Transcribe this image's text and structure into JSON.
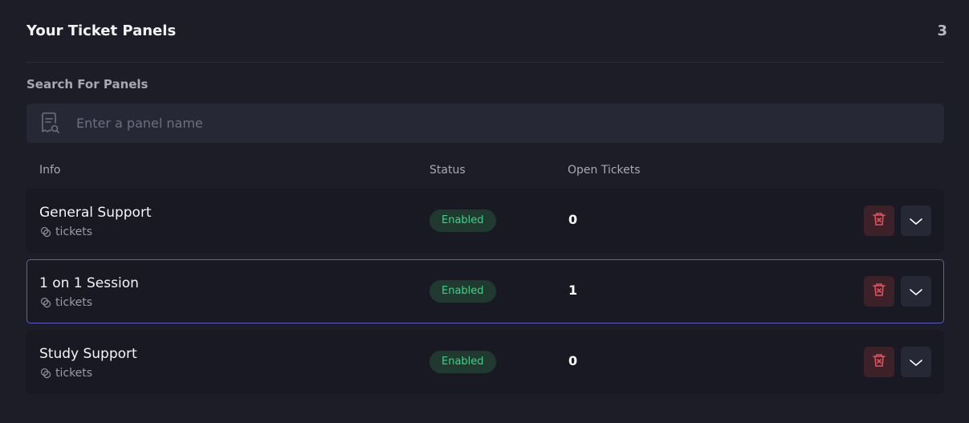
{
  "header": {
    "title": "Your Ticket Panels",
    "count": "3"
  },
  "search": {
    "label": "Search For Panels",
    "placeholder": "Enter a panel name",
    "value": ""
  },
  "table": {
    "columns": {
      "info": "Info",
      "status": "Status",
      "open_tickets": "Open Tickets"
    },
    "rows": [
      {
        "name": "General Support",
        "channel": "tickets",
        "status": "Enabled",
        "open_tickets": "0"
      },
      {
        "name": "1 on 1 Session",
        "channel": "tickets",
        "status": "Enabled",
        "open_tickets": "1"
      },
      {
        "name": "Study Support",
        "channel": "tickets",
        "status": "Enabled",
        "open_tickets": "0"
      }
    ]
  },
  "icons": {
    "search": "ticket-search-icon",
    "channel": "chat-bubbles-icon",
    "delete": "trash-icon",
    "expand": "chevron-down-icon"
  },
  "colors": {
    "background": "#1c1d27",
    "row": "#181922",
    "enabled_text": "#3fd18a",
    "enabled_bg": "#213a30",
    "delete": "#e0525e",
    "selected_border": "#5c5fc4"
  }
}
